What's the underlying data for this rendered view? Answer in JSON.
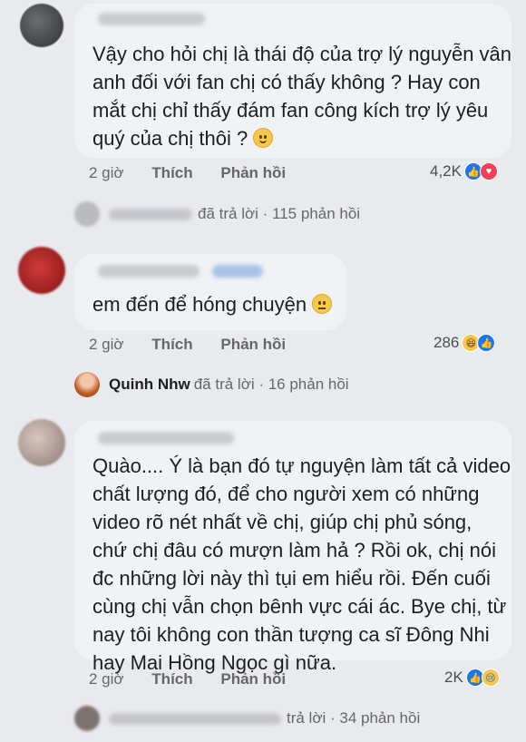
{
  "comments": [
    {
      "lines": [
        "Vậy cho hỏi chị là thái độ của trợ lý nguyễn vân",
        "anh đối với fan chị có thấy không ? Hay con",
        "mắt chị chỉ thấy đám fan công kích trợ lý yêu",
        "quý của chị thôi ?"
      ],
      "emoji": "slightly-smiling-face",
      "time": "2 giờ",
      "like_label": "Thích",
      "reply_label": "Phản hồi",
      "reaction_count": "4,2K",
      "reactions": [
        "like-icon",
        "love-icon"
      ],
      "reply_summary": "đã trả lời · 115 phản hồi"
    },
    {
      "lines": [
        "em đến để hóng chuyện"
      ],
      "emoji": "raised-eyebrow-face",
      "time": "2 giờ",
      "like_label": "Thích",
      "reply_label": "Phản hồi",
      "reaction_count": "286",
      "reactions": [
        "haha-icon",
        "like-icon"
      ],
      "reply_name": "Quinh Nhw",
      "reply_summary": "đã trả lời · 16 phản hồi"
    },
    {
      "lines": [
        "Quào.... Ý là bạn đó tự nguyện làm tất cả video",
        "chất lượng đó, để cho người xem có những",
        "video rõ nét nhất về chị, giúp chị phủ sóng,",
        "chứ chị đâu có mượn làm hả ? Rồi ok, chị nói",
        "đc những lời này thì tụi em hiểu rồi. Đến cuối",
        "cùng chị vẫn chọn bênh vực cái ác. Bye chị, từ",
        "nay tôi không con thần tượng ca sĩ Đông Nhi",
        "hay Mai Hồng Ngọc gì nữa."
      ],
      "time": "2 giờ",
      "like_label": "Thích",
      "reply_label": "Phản hồi",
      "reaction_count": "2K",
      "reactions": [
        "like-icon",
        "sad-icon"
      ],
      "reply_summary": "trả lời · 34 phản hồi"
    }
  ]
}
